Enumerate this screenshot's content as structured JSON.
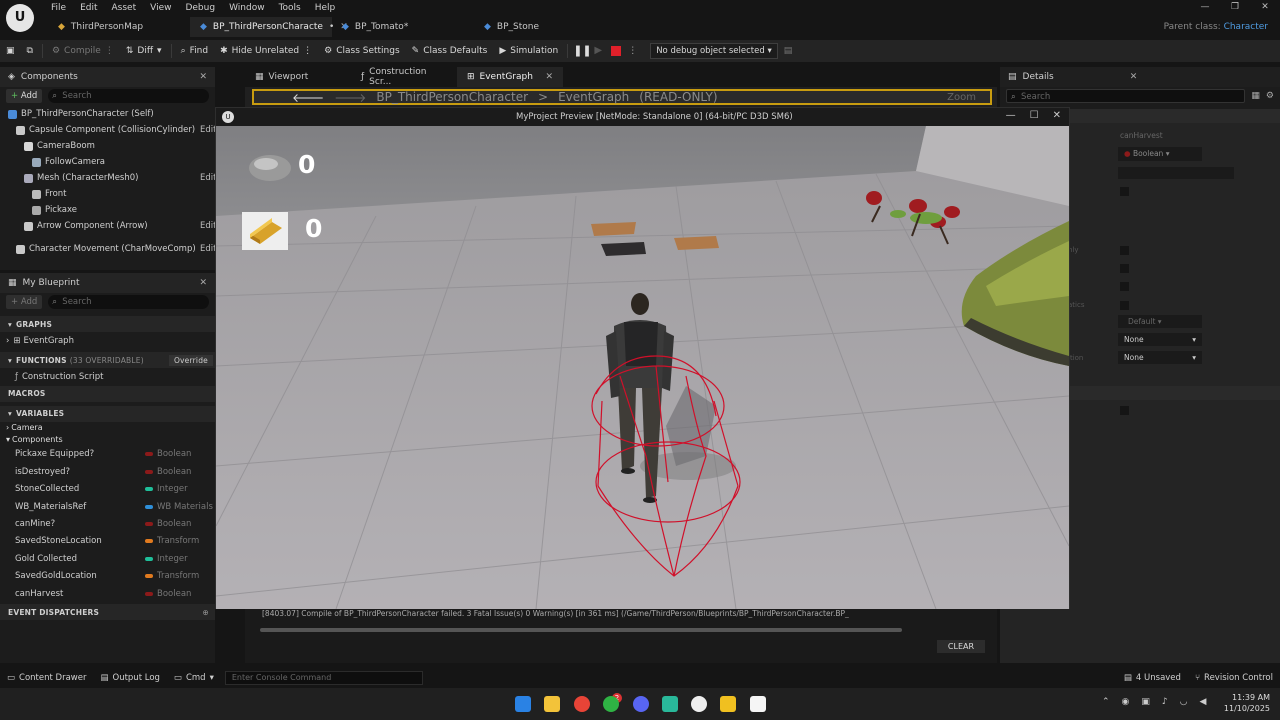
{
  "menu": [
    "File",
    "Edit",
    "Asset",
    "View",
    "Debug",
    "Window",
    "Tools",
    "Help"
  ],
  "doc_tabs": [
    {
      "label": "ThirdPersonMap",
      "active": false
    },
    {
      "label": "BP_ThirdPersonCharacte",
      "modified": "•",
      "active": true
    },
    {
      "label": "BP_Tomato*",
      "active": false
    },
    {
      "label": "BP_Stone",
      "active": false
    }
  ],
  "parent_class": {
    "label": "Parent class:",
    "value": "Character"
  },
  "toolbar": {
    "compile": "Compile",
    "diff": "Diff",
    "find": "Find",
    "hide_unrelated": "Hide Unrelated",
    "class_settings": "Class Settings",
    "class_defaults": "Class Defaults",
    "simulation": "Simulation",
    "debug_object": "No debug object selected"
  },
  "components": {
    "tab": "Components",
    "add": "Add",
    "search_placeholder": "Search",
    "tree": [
      {
        "label": "BP_ThirdPersonCharacter (Self)",
        "indent": 0
      },
      {
        "label": "Capsule Component (CollisionCylinder)",
        "indent": 1,
        "edit": "Edit"
      },
      {
        "label": "CameraBoom",
        "indent": 2
      },
      {
        "label": "FollowCamera",
        "indent": 3
      },
      {
        "label": "Mesh (CharacterMesh0)",
        "indent": 2,
        "edit": "Edit"
      },
      {
        "label": "Front",
        "indent": 3
      },
      {
        "label": "Pickaxe",
        "indent": 3
      },
      {
        "label": "Arrow Component (Arrow)",
        "indent": 2,
        "edit": "Edit"
      },
      {
        "label": "Character Movement (CharMoveComp)",
        "indent": 1,
        "edit": "Edit"
      }
    ]
  },
  "my_blueprint": {
    "tab": "My Blueprint",
    "add": "Add",
    "search_placeholder": "Search",
    "graphs_header": "GRAPHS",
    "event_graph": "EventGraph",
    "functions_header": "FUNCTIONS",
    "functions_count": "(33 OVERRIDABLE)",
    "override": "Override",
    "construction_script": "Construction Script",
    "macros_header": "MACROS",
    "variables_header": "VARIABLES",
    "categories": [
      "Camera",
      "Components"
    ],
    "variables": [
      {
        "name": "Pickaxe Equipped?",
        "type": "Boolean",
        "color": "#8c1a1a"
      },
      {
        "name": "isDestroyed?",
        "type": "Boolean",
        "color": "#8c1a1a"
      },
      {
        "name": "StoneCollected",
        "type": "Integer",
        "color": "#1fbf9a"
      },
      {
        "name": "WB_MaterialsRef",
        "type": "WB Materials",
        "color": "#2f8fd8"
      },
      {
        "name": "canMine?",
        "type": "Boolean",
        "color": "#8c1a1a"
      },
      {
        "name": "SavedStoneLocation",
        "type": "Transform",
        "color": "#e07a1f"
      },
      {
        "name": "Gold Collected",
        "type": "Integer",
        "color": "#1fbf9a"
      },
      {
        "name": "SavedGoldLocation",
        "type": "Transform",
        "color": "#e07a1f"
      },
      {
        "name": "canHarvest",
        "type": "Boolean",
        "color": "#8c1a1a"
      }
    ],
    "event_dispatchers_header": "EVENT DISPATCHERS"
  },
  "editor_tabs": [
    "Viewport",
    "Construction Scr...",
    "EventGraph"
  ],
  "graph": {
    "path": "BP_ThirdPersonCharacter",
    "sep": ">",
    "graph": "EventGraph",
    "mode": "(READ-ONLY)",
    "zoom": "Zoom"
  },
  "details": {
    "tab": "Details",
    "search_placeholder": "Search",
    "var_name": "canHarvest",
    "var_type": "Boolean",
    "frag1": "nly",
    "frag2": "atics",
    "frag3": "ition",
    "default": "Default",
    "none1": "None",
    "none2": "None"
  },
  "preview": {
    "title": "MyProject Preview [NetMode: Standalone 0]  (64-bit/PC D3D SM6)",
    "stone_count": "0",
    "gold_count": "0"
  },
  "log": {
    "line": "[8403.07] Compile of BP_ThirdPersonCharacter failed. 3 Fatal Issue(s) 0 Warning(s) [in 361 ms] (/Game/ThirdPerson/Blueprints/BP_ThirdPersonCharacter.BP_",
    "clear": "CLEAR"
  },
  "status": {
    "content_drawer": "Content Drawer",
    "output_log": "Output Log",
    "cmd": "Cmd",
    "console_placeholder": "Enter Console Command",
    "unsaved": "4 Unsaved",
    "revision_control": "Revision Control"
  },
  "taskbar": {
    "time": "11:39 AM",
    "date": "11/10/2025",
    "notif": "2"
  },
  "colors": {
    "accent": "#4a8bd8",
    "warning_border": "#c89c10",
    "collision": "#d0102a"
  }
}
